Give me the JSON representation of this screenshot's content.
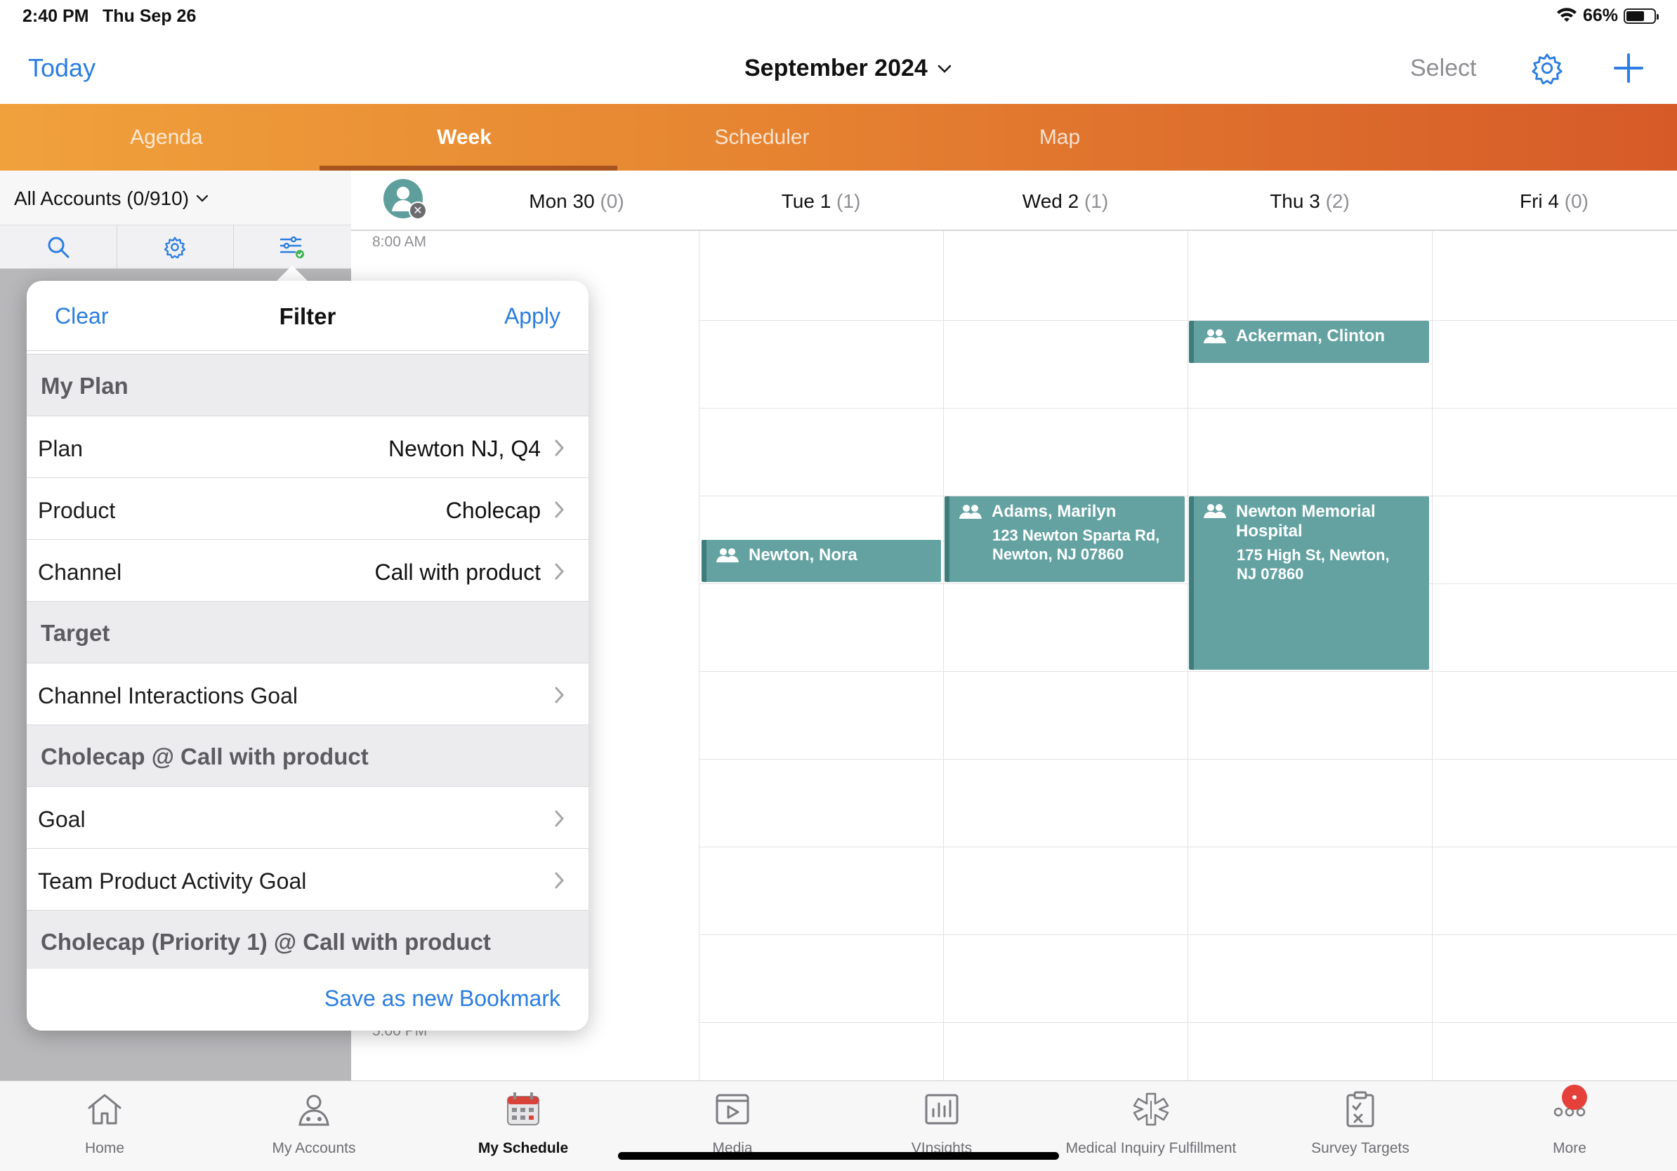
{
  "status_bar": {
    "time": "2:40 PM",
    "date": "Thu Sep 26",
    "battery": "66%"
  },
  "nav": {
    "today_label": "Today",
    "title": "September 2024",
    "select_label": "Select"
  },
  "tabs": [
    {
      "label": "Agenda"
    },
    {
      "label": "Week",
      "active": true
    },
    {
      "label": "Scheduler"
    },
    {
      "label": "Map"
    }
  ],
  "accounts": {
    "label": "All Accounts (0/910)"
  },
  "calendar": {
    "days": [
      {
        "label": "Mon 30",
        "count": "(0)"
      },
      {
        "label": "Tue 1",
        "count": "(1)"
      },
      {
        "label": "Wed 2",
        "count": "(1)"
      },
      {
        "label": "Thu 3",
        "count": "(2)"
      },
      {
        "label": "Fri 4",
        "count": "(0)"
      }
    ],
    "times": [
      "8:00 AM",
      "5:00 PM"
    ],
    "events": [
      {
        "title": "Ackerman, Clinton",
        "address": ""
      },
      {
        "title": "Newton, Nora",
        "address": ""
      },
      {
        "title": "Adams, Marilyn",
        "address": "123 Newton Sparta Rd, Newton, NJ 07860"
      },
      {
        "title": "Newton Memorial Hospital",
        "address": "175 High St, Newton, NJ 07860"
      }
    ]
  },
  "filter": {
    "clear_label": "Clear",
    "title": "Filter",
    "apply_label": "Apply",
    "sections": [
      {
        "title": "My Plan"
      },
      {
        "title": "Target"
      },
      {
        "title": "Cholecap @ Call with product"
      },
      {
        "title": "Cholecap (Priority 1) @ Call with product"
      }
    ],
    "rows": [
      {
        "label": "Plan",
        "value": "Newton NJ, Q4"
      },
      {
        "label": "Product",
        "value": "Cholecap"
      },
      {
        "label": "Channel",
        "value": "Call with product"
      },
      {
        "label": "Channel Interactions Goal",
        "value": ""
      },
      {
        "label": "Goal",
        "value": ""
      },
      {
        "label": "Team Product Activity Goal",
        "value": ""
      }
    ],
    "bookmark_label": "Save as new Bookmark"
  },
  "bottom_tabs": [
    {
      "label": "Home",
      "icon": "home-icon"
    },
    {
      "label": "My Accounts",
      "icon": "person-icon"
    },
    {
      "label": "My Schedule",
      "icon": "calendar-icon",
      "active": true
    },
    {
      "label": "Media",
      "icon": "media-icon"
    },
    {
      "label": "VInsights",
      "icon": "chart-icon"
    },
    {
      "label": "Medical Inquiry Fulfillment",
      "icon": "medical-icon"
    },
    {
      "label": "Survey Targets",
      "icon": "clipboard-icon"
    },
    {
      "label": "More",
      "icon": "more-icon"
    }
  ],
  "colors": {
    "accent": "#2b7de1",
    "event": "#64a2a2",
    "tab_start": "#f0a13c",
    "tab_end": "#d65a28",
    "badge": "#e5413a"
  }
}
